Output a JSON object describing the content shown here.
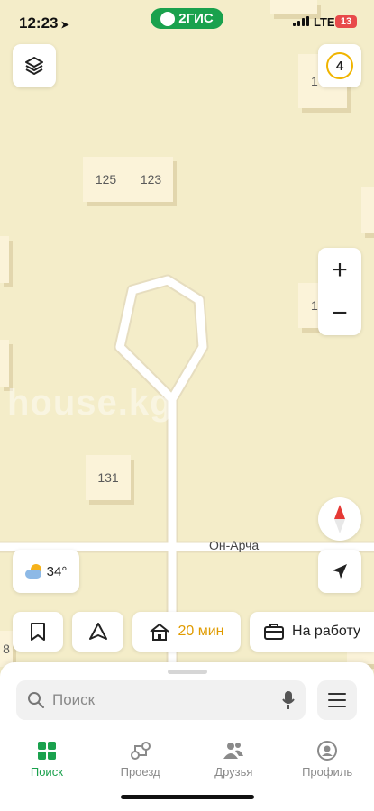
{
  "status_bar": {
    "time": "12:23",
    "network": "LTE",
    "battery": "13"
  },
  "brand": {
    "logo_text": "2ГИС"
  },
  "notifications": {
    "count": "4"
  },
  "map": {
    "buildings": [
      "125",
      "123",
      "131",
      "1",
      "1",
      "8"
    ],
    "street": "Он-Арча",
    "watermark": "house.kg"
  },
  "zoom": {
    "in": "+",
    "out": "−"
  },
  "weather": {
    "temp": "34°"
  },
  "quick_actions": {
    "home_eta": "20 мин",
    "work_label": "На работу"
  },
  "search": {
    "placeholder": "Поиск"
  },
  "tabs": [
    {
      "label": "Поиск",
      "icon": "grid-icon",
      "active": true
    },
    {
      "label": "Проезд",
      "icon": "route-icon",
      "active": false
    },
    {
      "label": "Друзья",
      "icon": "friends-icon",
      "active": false
    },
    {
      "label": "Профиль",
      "icon": "profile-icon",
      "active": false
    }
  ],
  "colors": {
    "brand": "#1aa14d",
    "accent": "#e09b00",
    "map_bg": "#f4edc9"
  }
}
